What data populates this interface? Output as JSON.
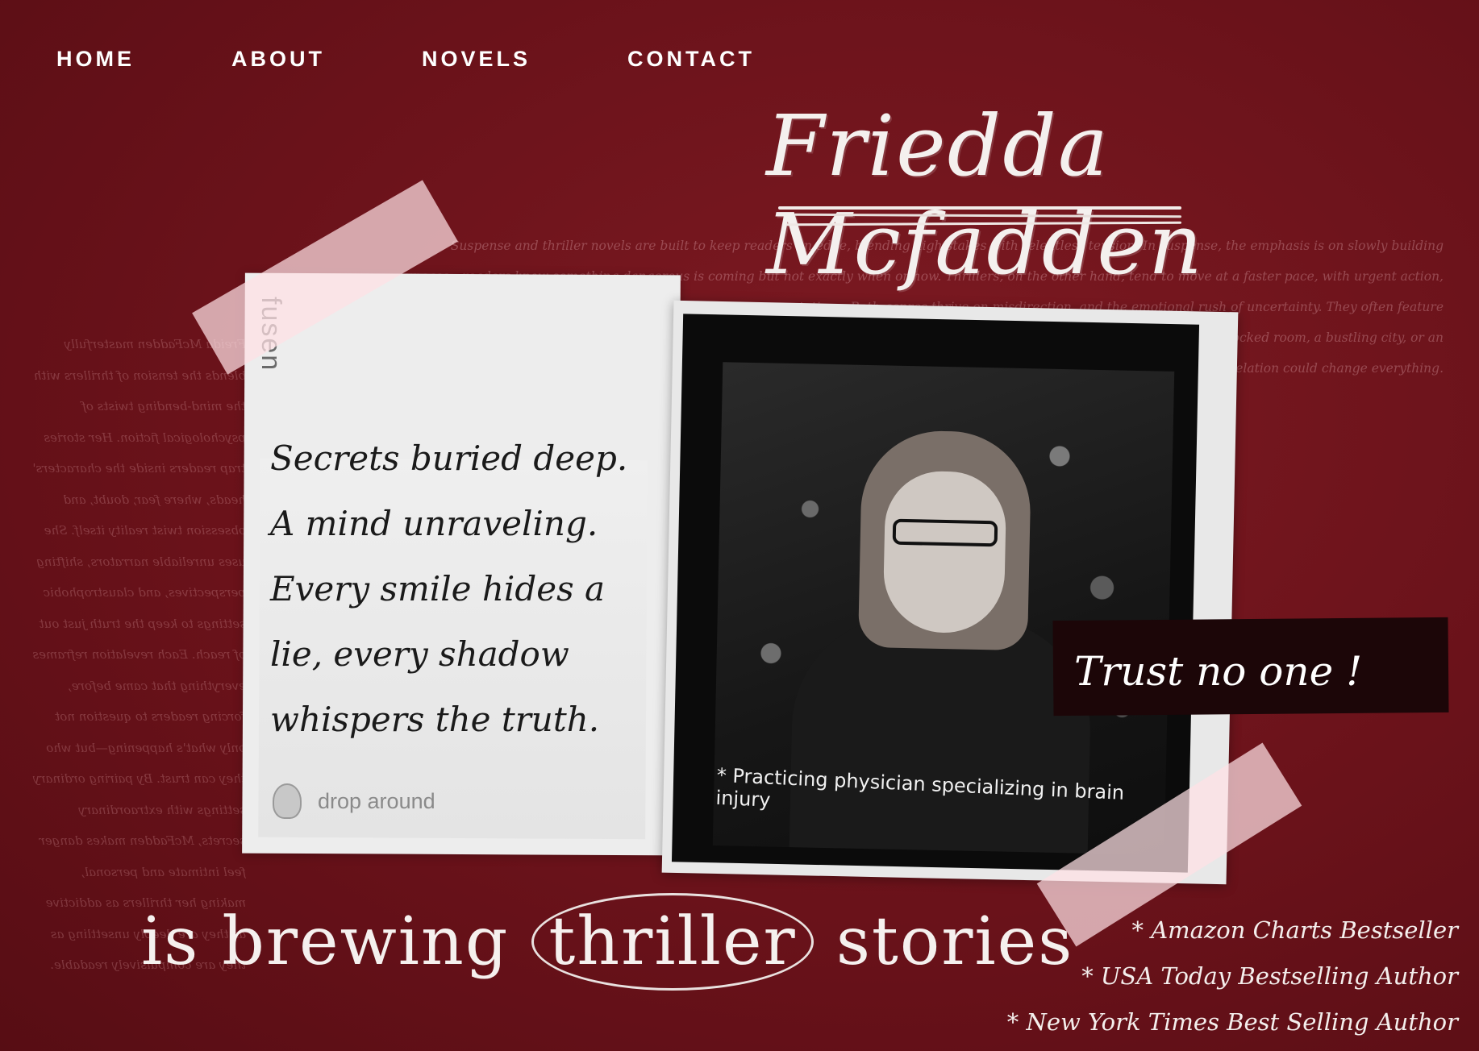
{
  "nav": {
    "home": "HOME",
    "about": "ABOUT",
    "novels": "NOVELS",
    "contact": "CONTACT"
  },
  "hero": {
    "author_name": "Friedda Mcfadden",
    "intro": "Suspense and thriller novels are built to keep readers on edge, blending high stakes with relentless tension. In suspense, the emphasis is on slowly building unease—readers know something dangerous is coming but not exactly when or how. Thrillers, on the other hand, tend to move at a faster pace, with urgent action, life-or-death scenarios, and twists that upset expectations. Both genres thrive on misdirection, and the emotional rush of uncertainty. They often feature mysterious characters, hidden motives, and escalating danger that forces characters into impossible choices. Whether set in a locked room, a bustling city, or an isolated cabin in the woods, these stories keep pages turning with the promise that the next revelation could change everything.",
    "left_column": "Freida McFadden masterfully blends the tension of thrillers with the mind-bending twists of psychological fiction. Her stories trap readers inside the characters' heads, where fear, doubt, and obsession twist reality itself. She uses unreliable narrators, shifting perspectives, and claustrophobic settings to keep the truth just out of reach. Each revelation reframes everything that came before, forcing readers to question not only what's happening—but who they can trust. By pairing ordinary settings with extraordinary secrets, McFadden makes danger feel intimate and personal, making her thrillers as addictive as they are deeply unsettling as they are compulsively readable."
  },
  "note": {
    "brand": "fusen",
    "poem": [
      "Secrets buried deep.",
      "A mind unraveling.",
      "Every smile hides a",
      "lie, every shadow",
      "whispers the truth."
    ],
    "footer": "drop around"
  },
  "photo": {
    "caption": "* Practicing physician specializing in brain injury"
  },
  "trust_line": "Trust no one !",
  "tagline": {
    "before": "is brewing",
    "highlight": "thriller",
    "after": "stories"
  },
  "credentials": [
    "* Amazon Charts Bestseller",
    "* USA Today Bestselling Author",
    "* New York Times Best Selling Author"
  ],
  "colors": {
    "background": "#6a121a",
    "text": "#ffffff",
    "band": "#1c0608"
  }
}
